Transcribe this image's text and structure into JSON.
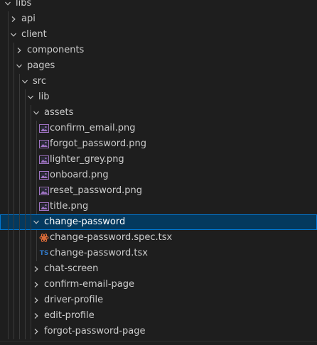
{
  "explorer": {
    "items": [
      {
        "label": "libs",
        "depth": 0,
        "kind": "folder",
        "open": true,
        "icon": "chevron-down-icon"
      },
      {
        "label": "api",
        "depth": 1,
        "kind": "folder",
        "open": false,
        "icon": "chevron-right-icon"
      },
      {
        "label": "client",
        "depth": 1,
        "kind": "folder",
        "open": true,
        "icon": "chevron-down-icon"
      },
      {
        "label": "components",
        "depth": 2,
        "kind": "folder",
        "open": false,
        "icon": "chevron-right-icon"
      },
      {
        "label": "pages",
        "depth": 2,
        "kind": "folder",
        "open": true,
        "icon": "chevron-down-icon"
      },
      {
        "label": "src",
        "depth": 3,
        "kind": "folder",
        "open": true,
        "icon": "chevron-down-icon"
      },
      {
        "label": "lib",
        "depth": 4,
        "kind": "folder",
        "open": true,
        "icon": "chevron-down-icon"
      },
      {
        "label": "assets",
        "depth": 5,
        "kind": "folder",
        "open": true,
        "icon": "chevron-down-icon"
      },
      {
        "label": "confirm_email.png",
        "depth": 6,
        "kind": "image",
        "icon": "image-file-icon"
      },
      {
        "label": "forgot_password.png",
        "depth": 6,
        "kind": "image",
        "icon": "image-file-icon"
      },
      {
        "label": "lighter_grey.png",
        "depth": 6,
        "kind": "image",
        "icon": "image-file-icon"
      },
      {
        "label": "onboard.png",
        "depth": 6,
        "kind": "image",
        "icon": "image-file-icon"
      },
      {
        "label": "reset_password.png",
        "depth": 6,
        "kind": "image",
        "icon": "image-file-icon"
      },
      {
        "label": "title.png",
        "depth": 6,
        "kind": "image",
        "icon": "image-file-icon"
      },
      {
        "label": "change-password",
        "depth": 5,
        "kind": "folder",
        "open": true,
        "selected": true,
        "icon": "chevron-down-icon"
      },
      {
        "label": "change-password.spec.tsx",
        "depth": 6,
        "kind": "spec",
        "icon": "react-spec-file-icon"
      },
      {
        "label": "change-password.tsx",
        "depth": 6,
        "kind": "ts",
        "icon": "typescript-file-icon",
        "badge": "TS"
      },
      {
        "label": "chat-screen",
        "depth": 5,
        "kind": "folder",
        "open": false,
        "icon": "chevron-right-icon"
      },
      {
        "label": "confirm-email-page",
        "depth": 5,
        "kind": "folder",
        "open": false,
        "icon": "chevron-right-icon"
      },
      {
        "label": "driver-profile",
        "depth": 5,
        "kind": "folder",
        "open": false,
        "icon": "chevron-right-icon"
      },
      {
        "label": "edit-profile",
        "depth": 5,
        "kind": "folder",
        "open": false,
        "icon": "chevron-right-icon"
      },
      {
        "label": "forgot-password-page",
        "depth": 5,
        "kind": "folder",
        "open": false,
        "icon": "chevron-right-icon"
      }
    ]
  },
  "colors": {
    "background": "#1e1e1e",
    "text": "#cccccc",
    "selected_bg": "#04395e",
    "selected_border": "#0078d4",
    "image_icon": "#a074c4",
    "ts_icon": "#3178c6",
    "spec_icon": "#e8703a"
  }
}
